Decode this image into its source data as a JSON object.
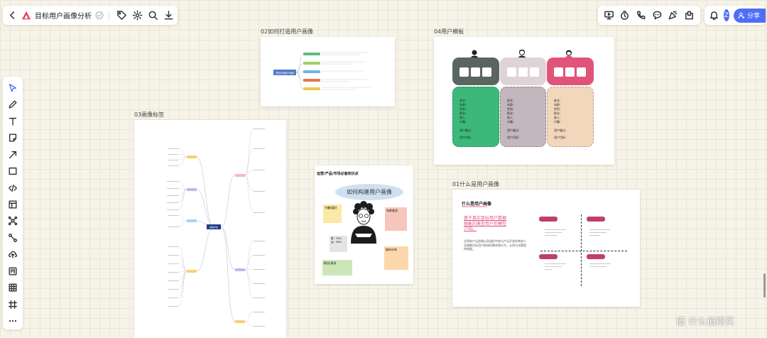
{
  "header": {
    "doc_title": "目标用户画像分析",
    "user_initial": "Z",
    "share_label": "分享"
  },
  "frames": {
    "f02": {
      "label": "02如何打造用户画像",
      "center": "如何打造用户画像"
    },
    "f04": {
      "label": "04用户模板",
      "fields_a": [
        "姓名：",
        "年龄：",
        "性别：",
        "职业：",
        "收入：",
        "兴趣："
      ],
      "fields_b": [
        "用户痛点：",
        "用户目标："
      ]
    },
    "f03": {
      "label": "03画像标签",
      "root": "画像标签"
    },
    "f05": {
      "title": "运营/产品/市场必备知识点",
      "bubble": "如何构建用户画像",
      "note_yellow": "兴趣/爱好",
      "note_pink": "年龄差异",
      "note_gray": "男：70%  女：30%",
      "note_orange": "城市分布",
      "note_green": "职业/身份"
    },
    "f01": {
      "label": "01什么是用户画像",
      "heading": "什么是用户画像",
      "headline": "基于真实目标用户数据抽象的典型用户的模型介绍。",
      "body": "它帮助产品经理以及组织中参与产品开发的其他人员理解目标用户群体的需求和行为，从而为决策提供依据。"
    }
  },
  "colors": {
    "accent": "#4f6ef7",
    "tmpl_dark": "#5b6560",
    "tmpl_mauve": "#ded3d6",
    "tmpl_red": "#e0547a",
    "tmpl_green": "#3cb97a",
    "tmpl_lilac": "#c3b6bd",
    "tmpl_peach": "#f3d7bb"
  },
  "watermark": "值 什么值得买"
}
